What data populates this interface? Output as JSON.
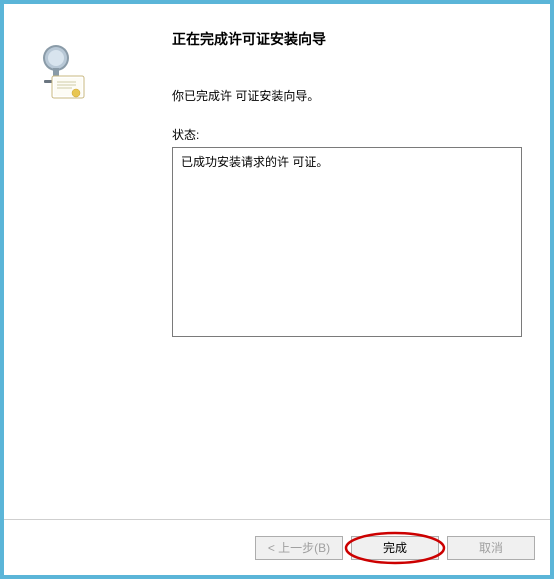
{
  "wizard": {
    "title": "正在完成许可证安装向导",
    "description": "你已完成许 可证安装向导。",
    "status_label": "状态:",
    "status_message": "已成功安装请求的许 可证。"
  },
  "buttons": {
    "back": "< 上一步(B)",
    "finish": "完成",
    "cancel": "取消"
  },
  "icons": {
    "wizard": "license-wizard-icon"
  }
}
